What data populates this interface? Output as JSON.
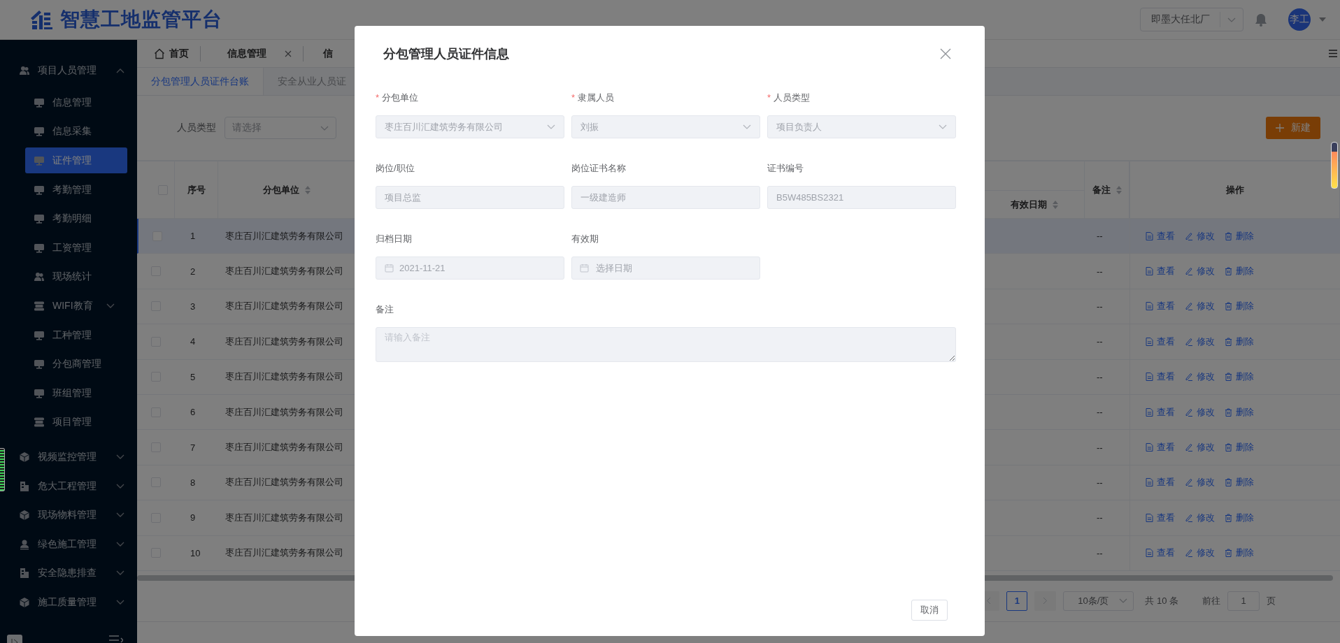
{
  "header": {
    "title": "智慧工地监管平台",
    "site_select": {
      "value": "即墨大任北厂"
    },
    "avatar": "李工"
  },
  "sidebar": {
    "items": [
      {
        "label": "项目人员管理",
        "kind": "people",
        "expanded": true,
        "children": [
          {
            "label": "信息管理",
            "kind": "monitor",
            "selected": false
          },
          {
            "label": "信息采集",
            "kind": "monitor",
            "selected": false
          },
          {
            "label": "证件管理",
            "kind": "monitor",
            "selected": true
          },
          {
            "label": "考勤管理",
            "kind": "monitor",
            "selected": false
          },
          {
            "label": "考勤明细",
            "kind": "monitor",
            "selected": false
          },
          {
            "label": "工资管理",
            "kind": "monitor",
            "selected": false
          },
          {
            "label": "现场统计",
            "kind": "people",
            "selected": false
          },
          {
            "label": "WIFI教育",
            "kind": "stack",
            "selected": false,
            "expanded": false
          },
          {
            "label": "工种管理",
            "kind": "monitor",
            "selected": false
          },
          {
            "label": "分包商管理",
            "kind": "monitor",
            "selected": false
          },
          {
            "label": "班组管理",
            "kind": "monitor",
            "selected": false
          },
          {
            "label": "项目管理",
            "kind": "stack",
            "selected": false
          }
        ]
      },
      {
        "label": "视频监控管理",
        "kind": "cube",
        "expanded": false
      },
      {
        "label": "危大工程管理",
        "kind": "building",
        "expanded": false
      },
      {
        "label": "现场物料管理",
        "kind": "cube",
        "expanded": false
      },
      {
        "label": "绿色施工管理",
        "kind": "person",
        "expanded": false
      },
      {
        "label": "安全隐患排查",
        "kind": "building",
        "expanded": false
      },
      {
        "label": "施工质量管理",
        "kind": "cube",
        "expanded": false
      }
    ]
  },
  "tabs": [
    {
      "label": "首页",
      "kind": "home"
    },
    {
      "label": "信息管理",
      "kind": "closable"
    },
    {
      "label": "信",
      "kind": "plain"
    }
  ],
  "subtabs": [
    {
      "label": "分包管理人员证件台账",
      "selected": true
    },
    {
      "label": "安全从业人员证",
      "selected": false
    }
  ],
  "filter": {
    "label": "人员类型",
    "placeholder": "请选择"
  },
  "new_button": "新建",
  "table": {
    "select_all": {
      "checked": false
    },
    "columns": [
      {
        "label": "序号",
        "sortable": false
      },
      {
        "label": "分包单位",
        "sortable": true
      },
      {
        "label": "有效日期",
        "sortable": true
      },
      {
        "label": "备注",
        "sortable": true
      },
      {
        "label": "操作",
        "sortable": false
      }
    ],
    "rows": [
      {
        "index": "1",
        "company": "枣庄百川汇建筑劳务有限公司",
        "remark": "--",
        "checked": false,
        "highlighted": true,
        "actions": [
          {
            "label": "查看",
            "kind": "view"
          },
          {
            "label": "修改",
            "kind": "edit"
          },
          {
            "label": "删除",
            "kind": "delete"
          }
        ]
      },
      {
        "index": "2",
        "company": "枣庄百川汇建筑劳务有限公司",
        "remark": "--",
        "checked": false,
        "highlighted": false,
        "actions": [
          {
            "label": "查看",
            "kind": "view"
          },
          {
            "label": "修改",
            "kind": "edit"
          },
          {
            "label": "删除",
            "kind": "delete"
          }
        ]
      },
      {
        "index": "3",
        "company": "枣庄百川汇建筑劳务有限公司",
        "remark": "--",
        "checked": false,
        "highlighted": false,
        "actions": [
          {
            "label": "查看",
            "kind": "view"
          },
          {
            "label": "修改",
            "kind": "edit"
          },
          {
            "label": "删除",
            "kind": "delete"
          }
        ]
      },
      {
        "index": "4",
        "company": "枣庄百川汇建筑劳务有限公司",
        "remark": "--",
        "checked": false,
        "highlighted": false,
        "actions": [
          {
            "label": "查看",
            "kind": "view"
          },
          {
            "label": "修改",
            "kind": "edit"
          },
          {
            "label": "删除",
            "kind": "delete"
          }
        ]
      },
      {
        "index": "5",
        "company": "枣庄百川汇建筑劳务有限公司",
        "remark": "--",
        "checked": false,
        "highlighted": false,
        "actions": [
          {
            "label": "查看",
            "kind": "view"
          },
          {
            "label": "修改",
            "kind": "edit"
          },
          {
            "label": "删除",
            "kind": "delete"
          }
        ]
      },
      {
        "index": "6",
        "company": "枣庄百川汇建筑劳务有限公司",
        "remark": "--",
        "checked": false,
        "highlighted": false,
        "actions": [
          {
            "label": "查看",
            "kind": "view"
          },
          {
            "label": "修改",
            "kind": "edit"
          },
          {
            "label": "删除",
            "kind": "delete"
          }
        ]
      },
      {
        "index": "7",
        "company": "枣庄百川汇建筑劳务有限公司",
        "remark": "--",
        "checked": false,
        "highlighted": false,
        "actions": [
          {
            "label": "查看",
            "kind": "view"
          },
          {
            "label": "修改",
            "kind": "edit"
          },
          {
            "label": "删除",
            "kind": "delete"
          }
        ]
      },
      {
        "index": "8",
        "company": "枣庄百川汇建筑劳务有限公司",
        "remark": "--",
        "checked": false,
        "highlighted": false,
        "actions": [
          {
            "label": "查看",
            "kind": "view"
          },
          {
            "label": "修改",
            "kind": "edit"
          },
          {
            "label": "删除",
            "kind": "delete"
          }
        ]
      },
      {
        "index": "9",
        "company": "枣庄百川汇建筑劳务有限公司",
        "remark": "--",
        "checked": false,
        "highlighted": false,
        "actions": [
          {
            "label": "查看",
            "kind": "view"
          },
          {
            "label": "修改",
            "kind": "edit"
          },
          {
            "label": "删除",
            "kind": "delete"
          }
        ]
      },
      {
        "index": "10",
        "company": "枣庄百川汇建筑劳务有限公司",
        "remark": "--",
        "checked": false,
        "highlighted": false,
        "actions": [
          {
            "label": "查看",
            "kind": "view"
          },
          {
            "label": "修改",
            "kind": "edit"
          },
          {
            "label": "删除",
            "kind": "delete"
          }
        ]
      }
    ]
  },
  "pagination": {
    "pages": [
      {
        "label": "1",
        "selected": true
      }
    ],
    "page_size": "10条/页",
    "total": "共 10 条",
    "goto_label": "前往",
    "goto_value": "1",
    "page_unit": "页"
  },
  "dialog": {
    "title": "分包管理人员证件信息",
    "fields": [
      {
        "label": "分包单位",
        "required_mark": "*",
        "kind": "select",
        "value": "枣庄百川汇建筑劳务有限公司",
        "disabled": true
      },
      {
        "label": "隶属人员",
        "required_mark": "*",
        "kind": "select",
        "value": "刘振",
        "disabled": true
      },
      {
        "label": "人员类型",
        "required_mark": "*",
        "kind": "select",
        "value": "项目负责人",
        "disabled": true
      },
      {
        "label": "岗位/职位",
        "kind": "text",
        "value": "项目总监",
        "disabled": true
      },
      {
        "label": "岗位证书名称",
        "kind": "text",
        "value": "一级建造师",
        "disabled": true
      },
      {
        "label": "证书编号",
        "kind": "text",
        "value": "B5W485BS2321",
        "disabled": true
      },
      {
        "label": "归档日期",
        "kind": "date",
        "value": "2021-11-21",
        "disabled": true
      },
      {
        "label": "有效期",
        "kind": "date",
        "placeholder": "选择日期",
        "disabled": true
      },
      {
        "label": "备注",
        "kind": "textarea",
        "placeholder": "请输入备注",
        "disabled": true
      }
    ],
    "cancel_button": "取消"
  }
}
